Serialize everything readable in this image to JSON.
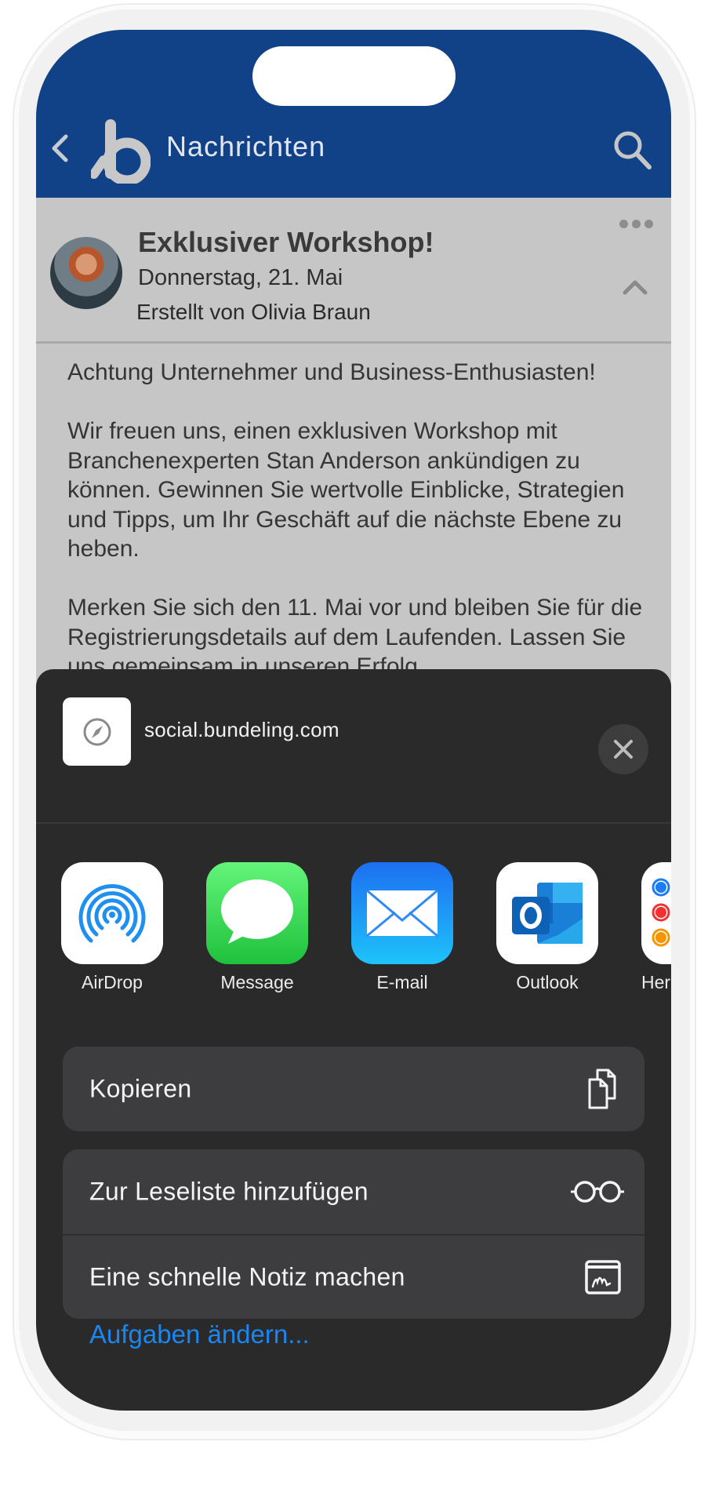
{
  "header": {
    "title": "Nachrichten",
    "back_icon": "chevron-left-icon",
    "logo": "bundeling-logo",
    "search_icon": "search-icon",
    "background_color": "#114288"
  },
  "message": {
    "title": "Exklusiver Workshop!",
    "date": "Donnerstag, 21. Mai",
    "author": "Erstellt von Olivia Braun",
    "more_icon": "ellipsis-icon",
    "collapse_icon": "chevron-up-icon",
    "body": [
      "Achtung Unternehmer und Business-Enthusiasten!",
      "Wir freuen uns, einen exklusiven Workshop mit Branchenexperten Stan Anderson ankündigen zu können. Gewinnen Sie wertvolle Einblicke, Strategien und Tipps, um Ihr Geschäft auf die nächste Ebene zu heben.",
      "Merken Sie sich den 11. Mai vor und bleiben Sie für die Registrierungsdetails auf dem Laufenden. Lassen Sie uns gemeinsam in unseren Erfolg"
    ]
  },
  "share_sheet": {
    "url": "social.bundeling.com",
    "url_icon": "compass-icon",
    "close_icon": "close-icon",
    "apps": [
      {
        "label": "AirDrop",
        "icon": "airdrop-icon"
      },
      {
        "label": "Message",
        "icon": "messages-icon"
      },
      {
        "label": "E-mail",
        "icon": "mail-icon"
      },
      {
        "label": "Outlook",
        "icon": "outlook-icon"
      },
      {
        "label": "Herin",
        "icon": "reminders-icon"
      }
    ],
    "actions": [
      {
        "label": "Kopieren",
        "icon": "copy-icon"
      },
      {
        "label": "Zur Leseliste hinzufügen",
        "icon": "glasses-icon"
      },
      {
        "label": "Eine schnelle Notiz machen",
        "icon": "quick-note-icon"
      }
    ],
    "edit_actions_label": "Aufgaben ändern...",
    "link_color": "#1a86f1"
  }
}
